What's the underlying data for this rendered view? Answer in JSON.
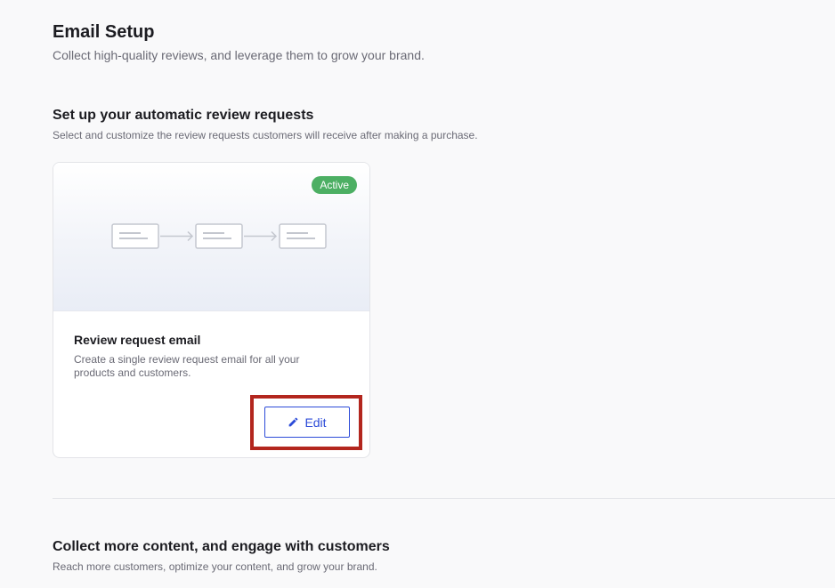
{
  "header": {
    "title": "Email Setup",
    "subtitle": "Collect high-quality reviews, and leverage them to grow your brand."
  },
  "review_requests": {
    "title": "Set up your automatic review requests",
    "subtitle": "Select and customize the review requests customers will receive after making a purchase.",
    "card": {
      "status_badge": "Active",
      "status_color": "#4caf63",
      "title": "Review request email",
      "description": "Create a single review request email for all your products and customers.",
      "edit_label": "Edit",
      "edit_icon": "pencil-icon",
      "accent_color": "#2c4bd8"
    }
  },
  "engage": {
    "title": "Collect more content, and engage with customers",
    "subtitle": "Reach more customers, optimize your content, and grow your brand."
  }
}
